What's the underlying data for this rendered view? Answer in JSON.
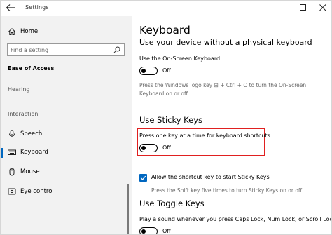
{
  "window": {
    "title": "Settings"
  },
  "sidebar": {
    "home_label": "Home",
    "search_placeholder": "Find a setting",
    "section_heading": "Ease of Access",
    "groups": {
      "hearing": "Hearing",
      "interaction": "Interaction"
    },
    "items": [
      {
        "label": "Speech",
        "icon": "microphone-icon"
      },
      {
        "label": "Keyboard",
        "icon": "keyboard-icon",
        "selected": true
      },
      {
        "label": "Mouse",
        "icon": "mouse-icon"
      },
      {
        "label": "Eye control",
        "icon": "eye-icon"
      }
    ]
  },
  "content": {
    "title": "Keyboard",
    "subtitle": "Use your device without a physical keyboard",
    "onscreen": {
      "label": "Use the On-Screen Keyboard",
      "state": "Off",
      "description_line1": "Press the Windows logo key ⊞ + Ctrl + O to turn the On-Screen",
      "description_line2": "Keyboard on or off."
    },
    "sticky": {
      "heading": "Use Sticky Keys",
      "label": "Press one key at a time for keyboard shortcuts",
      "state": "Off",
      "shortcut_checkbox_label": "Allow the shortcut key to start Sticky Keys",
      "shortcut_checked": true,
      "description": "Press the Shift key five times to turn Sticky Keys on or off"
    },
    "toggle_keys": {
      "heading": "Use Toggle Keys",
      "label": "Play a sound whenever you press Caps Lock, Num Lock, or Scroll Lock",
      "state": "Off"
    }
  },
  "colors": {
    "accent": "#0067c0",
    "highlight": "#e02020",
    "sidebar_bg": "#f2f2f2"
  }
}
